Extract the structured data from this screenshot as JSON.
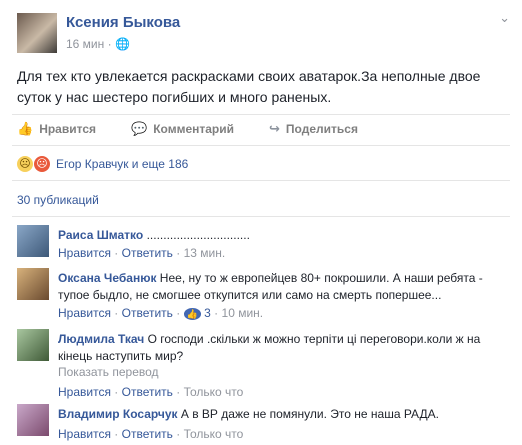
{
  "post": {
    "author": "Ксения Быкова",
    "time": "16 мин",
    "privacy_icon": "globe-icon",
    "text": "Для тех кто увлекается раскрасками своих аватарок.За неполные двое суток у нас шестеро погибших и много раненых."
  },
  "actions": {
    "like": "Нравится",
    "comment": "Комментарий",
    "share": "Поделиться"
  },
  "reactions": {
    "summary": "Егор Кравчук и еще 186"
  },
  "publications": "30 публикаций",
  "comments": [
    {
      "name": "Раиса Шматко",
      "text": " ...............................",
      "like": "Нравится",
      "reply": "Ответить",
      "time": "13 мин."
    },
    {
      "name": "Оксана Чебанюк",
      "text": " Нее, ну то ж европейцев 80+ покрошили. А наши ребята - тупое быдло, не смогшее откупится или само на смерть попершее...",
      "like": "Нравится",
      "reply": "Ответить",
      "likes_count": "3",
      "time": "10 мин."
    },
    {
      "name": "Людмила Ткач",
      "text": " О господи .скільки ж можно терпіти ці переговори.коли ж на кінець наступить мир?",
      "translate": "Показать перевод",
      "like": "Нравится",
      "reply": "Ответить",
      "time": "Только что"
    },
    {
      "name": "Владимир Косарчук",
      "text": " А в ВР даже не помянули. Это не наша РАДА.",
      "like": "Нравится",
      "reply": "Ответить",
      "time": "Только что"
    }
  ]
}
